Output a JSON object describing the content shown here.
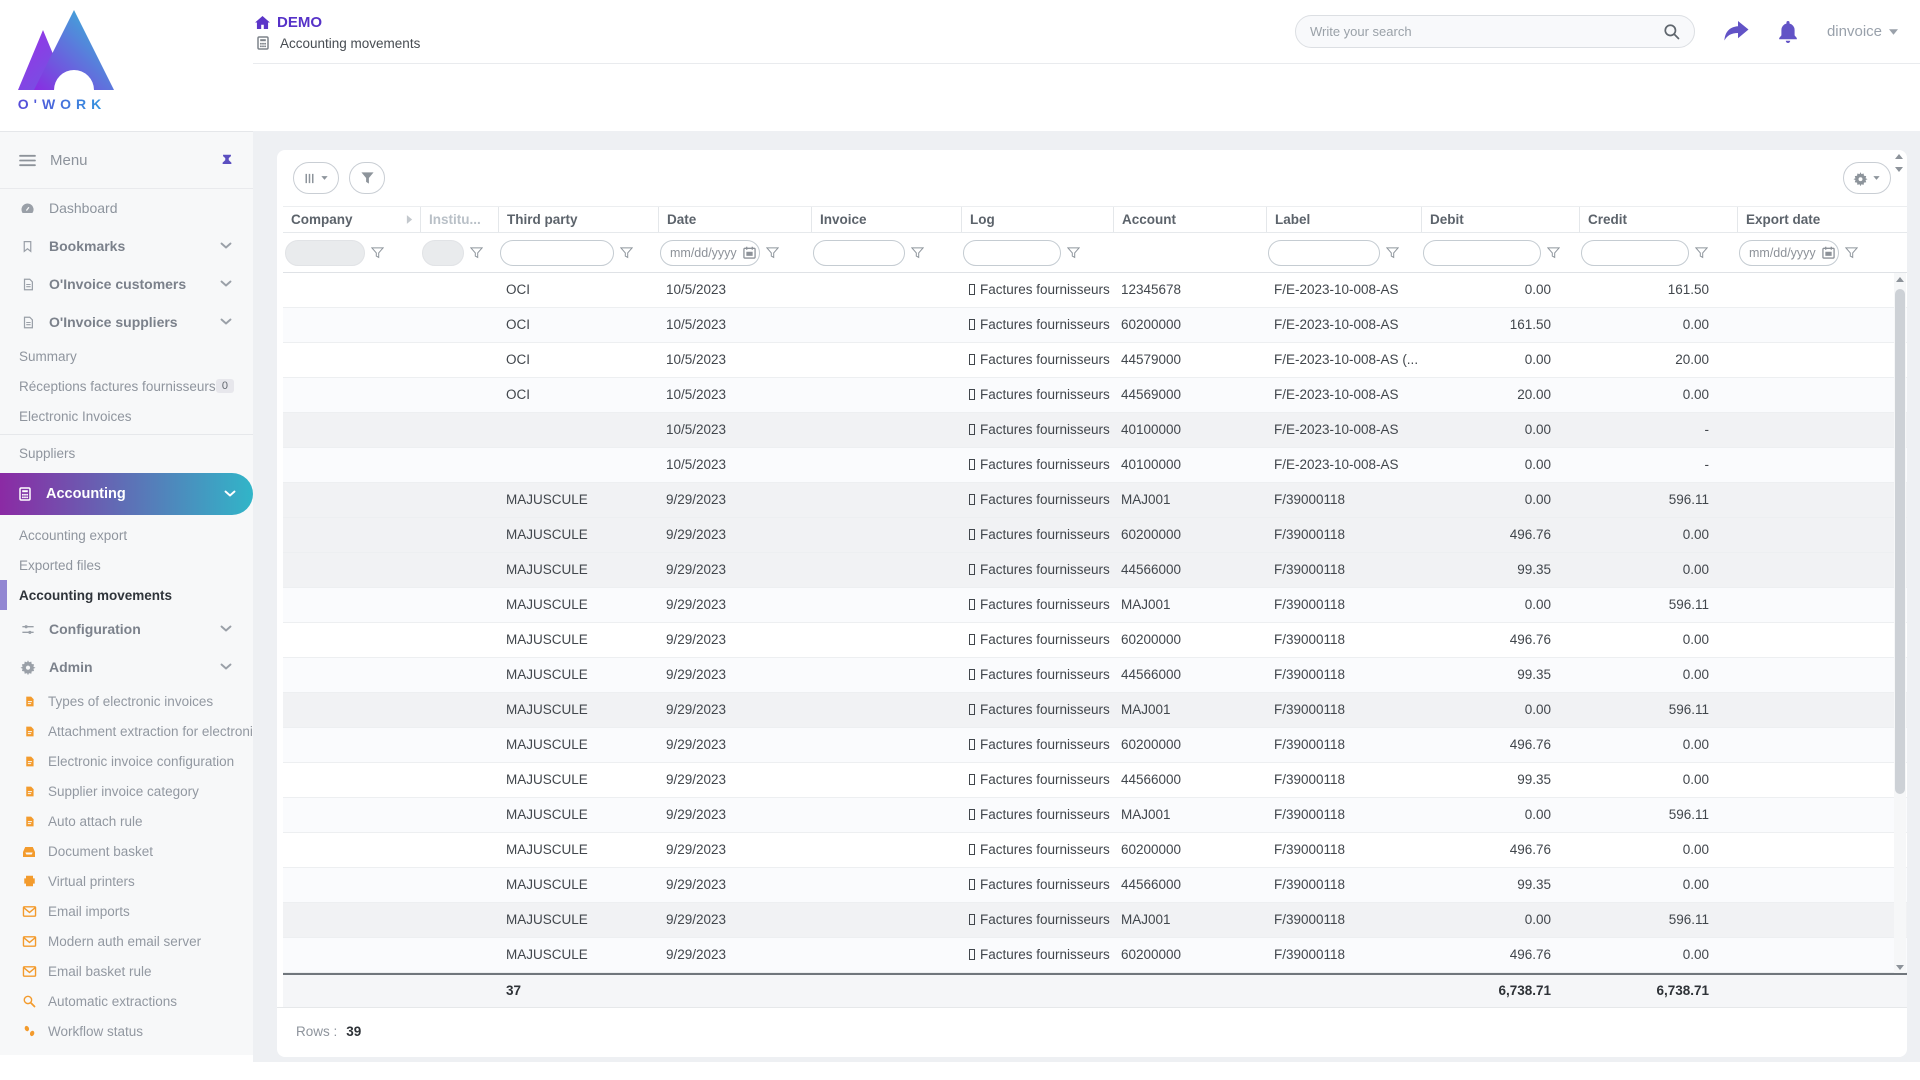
{
  "header": {
    "brand": "O'WORK",
    "app_title": "DEMO",
    "page_title": "Accounting movements",
    "search_placeholder": "Write your search",
    "user_name": "dinvoice"
  },
  "sidebar": {
    "menu_label": "Menu",
    "items": [
      {
        "type": "main",
        "icon": "dashboard",
        "label": "Dashboard"
      },
      {
        "type": "main",
        "icon": "bookmark",
        "label": "Bookmarks",
        "chevron": true,
        "bold": true
      },
      {
        "type": "main",
        "icon": "invoice",
        "label": "O'Invoice customers",
        "chevron": true,
        "bold": true
      },
      {
        "type": "main",
        "icon": "invoice",
        "label": "O'Invoice suppliers",
        "chevron": true,
        "bold": true
      },
      {
        "type": "sub",
        "label": "Summary"
      },
      {
        "type": "sub",
        "label": "Réceptions factures fournisseurs",
        "badge": "0"
      },
      {
        "type": "sub",
        "label": "Electronic Invoices",
        "divider_after": true
      },
      {
        "type": "sub",
        "label": "Suppliers"
      },
      {
        "type": "accent",
        "icon": "calculator",
        "label": "Accounting",
        "chevron": true
      },
      {
        "type": "sub",
        "label": "Accounting export"
      },
      {
        "type": "sub",
        "label": "Exported files"
      },
      {
        "type": "sub",
        "label": "Accounting movements",
        "active": true
      },
      {
        "type": "main",
        "icon": "sliders",
        "label": "Configuration",
        "chevron": true,
        "bold": true
      },
      {
        "type": "main",
        "icon": "gear",
        "label": "Admin",
        "chevron": true,
        "bold": true
      },
      {
        "type": "admin",
        "icon": "doc",
        "label": "Types of electronic invoices"
      },
      {
        "type": "admin",
        "icon": "doc",
        "label": "Attachment extraction for electroni"
      },
      {
        "type": "admin",
        "icon": "doc",
        "label": "Electronic invoice configuration"
      },
      {
        "type": "admin",
        "icon": "doc",
        "label": "Supplier invoice category"
      },
      {
        "type": "admin",
        "icon": "doc",
        "label": "Auto attach rule"
      },
      {
        "type": "admin",
        "icon": "basket",
        "label": "Document basket"
      },
      {
        "type": "admin",
        "icon": "printer",
        "label": "Virtual printers"
      },
      {
        "type": "admin",
        "icon": "mail",
        "label": "Email imports"
      },
      {
        "type": "admin",
        "icon": "mail",
        "label": "Modern auth email server"
      },
      {
        "type": "admin",
        "icon": "mail",
        "label": "Email basket rule"
      },
      {
        "type": "admin",
        "icon": "magnifier",
        "label": "Automatic extractions"
      },
      {
        "type": "admin",
        "icon": "footprints",
        "label": "Workflow status"
      }
    ]
  },
  "table": {
    "date_placeholder": "mm/dd/yyyy",
    "columns": [
      {
        "label": "Company",
        "filter": "disabled",
        "funnel": true
      },
      {
        "label": "",
        "filter": "none",
        "arrow": true
      },
      {
        "label": "Institu...",
        "filter": "disabled",
        "funnel": true,
        "muted": true
      },
      {
        "label": "Third party",
        "filter": "text",
        "funnel": true
      },
      {
        "label": "Date",
        "filter": "date",
        "funnel": true
      },
      {
        "label": "Invoice",
        "filter": "text",
        "funnel": true
      },
      {
        "label": "Log",
        "filter": "text",
        "funnel": true
      },
      {
        "label": "Account",
        "filter": "none"
      },
      {
        "label": "Label",
        "filter": "text",
        "funnel": true
      },
      {
        "label": "Debit",
        "filter": "text",
        "funnel": true
      },
      {
        "label": "Credit",
        "filter": "text",
        "funnel": true
      },
      {
        "label": "Export date",
        "filter": "date",
        "funnel": true
      }
    ],
    "rows": [
      {
        "third_party": "OCI",
        "date": "10/5/2023",
        "log": "Factures fournisseurs",
        "account": "12345678",
        "label": "F/E-2023-10-008-AS",
        "debit": "0.00",
        "credit": "161.50"
      },
      {
        "third_party": "OCI",
        "date": "10/5/2023",
        "log": "Factures fournisseurs",
        "account": "60200000",
        "label": "F/E-2023-10-008-AS",
        "debit": "161.50",
        "credit": "0.00"
      },
      {
        "third_party": "OCI",
        "date": "10/5/2023",
        "log": "Factures fournisseurs",
        "account": "44579000",
        "label": "F/E-2023-10-008-AS (...",
        "debit": "0.00",
        "credit": "20.00"
      },
      {
        "third_party": "OCI",
        "date": "10/5/2023",
        "log": "Factures fournisseurs",
        "account": "44569000",
        "label": "F/E-2023-10-008-AS",
        "debit": "20.00",
        "credit": "0.00"
      },
      {
        "third_party": "",
        "date": "10/5/2023",
        "log": "Factures fournisseurs",
        "account": "40100000",
        "label": "F/E-2023-10-008-AS",
        "debit": "0.00",
        "credit": "-"
      },
      {
        "third_party": "",
        "date": "10/5/2023",
        "log": "Factures fournisseurs",
        "account": "40100000",
        "label": "F/E-2023-10-008-AS",
        "debit": "0.00",
        "credit": "-"
      },
      {
        "third_party": "MAJUSCULE",
        "date": "9/29/2023",
        "log": "Factures fournisseurs",
        "account": "MAJ001",
        "label": "F/39000118",
        "debit": "0.00",
        "credit": "596.11"
      },
      {
        "third_party": "MAJUSCULE",
        "date": "9/29/2023",
        "log": "Factures fournisseurs",
        "account": "60200000",
        "label": "F/39000118",
        "debit": "496.76",
        "credit": "0.00"
      },
      {
        "third_party": "MAJUSCULE",
        "date": "9/29/2023",
        "log": "Factures fournisseurs",
        "account": "44566000",
        "label": "F/39000118",
        "debit": "99.35",
        "credit": "0.00"
      },
      {
        "third_party": "MAJUSCULE",
        "date": "9/29/2023",
        "log": "Factures fournisseurs",
        "account": "MAJ001",
        "label": "F/39000118",
        "debit": "0.00",
        "credit": "596.11"
      },
      {
        "third_party": "MAJUSCULE",
        "date": "9/29/2023",
        "log": "Factures fournisseurs",
        "account": "60200000",
        "label": "F/39000118",
        "debit": "496.76",
        "credit": "0.00"
      },
      {
        "third_party": "MAJUSCULE",
        "date": "9/29/2023",
        "log": "Factures fournisseurs",
        "account": "44566000",
        "label": "F/39000118",
        "debit": "99.35",
        "credit": "0.00"
      },
      {
        "third_party": "MAJUSCULE",
        "date": "9/29/2023",
        "log": "Factures fournisseurs",
        "account": "MAJ001",
        "label": "F/39000118",
        "debit": "0.00",
        "credit": "596.11"
      },
      {
        "third_party": "MAJUSCULE",
        "date": "9/29/2023",
        "log": "Factures fournisseurs",
        "account": "60200000",
        "label": "F/39000118",
        "debit": "496.76",
        "credit": "0.00"
      },
      {
        "third_party": "MAJUSCULE",
        "date": "9/29/2023",
        "log": "Factures fournisseurs",
        "account": "44566000",
        "label": "F/39000118",
        "debit": "99.35",
        "credit": "0.00"
      },
      {
        "third_party": "MAJUSCULE",
        "date": "9/29/2023",
        "log": "Factures fournisseurs",
        "account": "MAJ001",
        "label": "F/39000118",
        "debit": "0.00",
        "credit": "596.11"
      },
      {
        "third_party": "MAJUSCULE",
        "date": "9/29/2023",
        "log": "Factures fournisseurs",
        "account": "60200000",
        "label": "F/39000118",
        "debit": "496.76",
        "credit": "0.00"
      },
      {
        "third_party": "MAJUSCULE",
        "date": "9/29/2023",
        "log": "Factures fournisseurs",
        "account": "44566000",
        "label": "F/39000118",
        "debit": "99.35",
        "credit": "0.00"
      },
      {
        "third_party": "MAJUSCULE",
        "date": "9/29/2023",
        "log": "Factures fournisseurs",
        "account": "MAJ001",
        "label": "F/39000118",
        "debit": "0.00",
        "credit": "596.11"
      },
      {
        "third_party": "MAJUSCULE",
        "date": "9/29/2023",
        "log": "Factures fournisseurs",
        "account": "60200000",
        "label": "F/39000118",
        "debit": "496.76",
        "credit": "0.00"
      }
    ],
    "footer": {
      "third_party_total": "37",
      "debit_total": "6,738.71",
      "credit_total": "6,738.71"
    },
    "rows_label": "Rows :",
    "rows_count": "39"
  },
  "colors": {
    "accent_purple": "#5632c8",
    "icon_purple": "#6253c6",
    "accent_gradient_start": "#8b2aa4",
    "accent_gradient_end": "#31b5c8",
    "admin_icon_orange": "#f39b2d"
  }
}
